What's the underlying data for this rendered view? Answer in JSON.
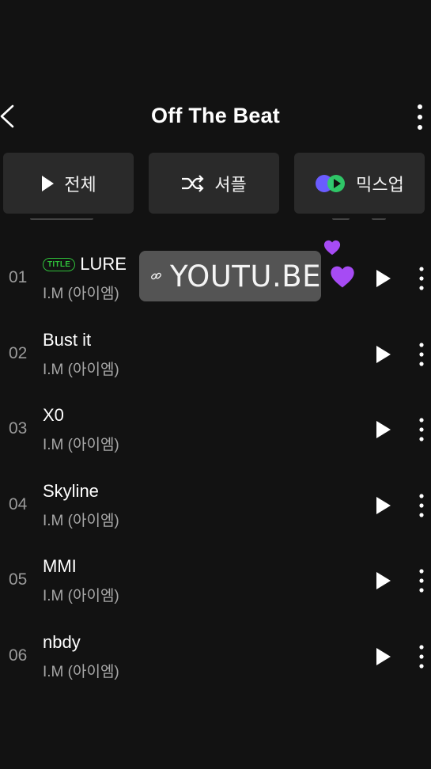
{
  "header": {
    "title": "Off The Beat"
  },
  "actions": {
    "play_all": "전체",
    "shuffle": "셔플",
    "mixup": "믹스업"
  },
  "tracks": [
    {
      "number": "01",
      "title": "LURE",
      "artist": "I.M (아이엠)",
      "badge": "TITLE"
    },
    {
      "number": "02",
      "title": "Bust it",
      "artist": "I.M (아이엠)"
    },
    {
      "number": "03",
      "title": "X0",
      "artist": "I.M (아이엠)"
    },
    {
      "number": "04",
      "title": "Skyline",
      "artist": "I.M (아이엠)"
    },
    {
      "number": "05",
      "title": "MMI",
      "artist": "I.M (아이엠)"
    },
    {
      "number": "06",
      "title": "nbdy",
      "artist": "I.M (아이엠)"
    }
  ],
  "sticker": {
    "link_text": "YOUTU.BE"
  },
  "colors": {
    "background": "#121212",
    "button": "#2a2a2a",
    "title_badge": "#2fbf3a",
    "heart": "#a64bf4"
  }
}
